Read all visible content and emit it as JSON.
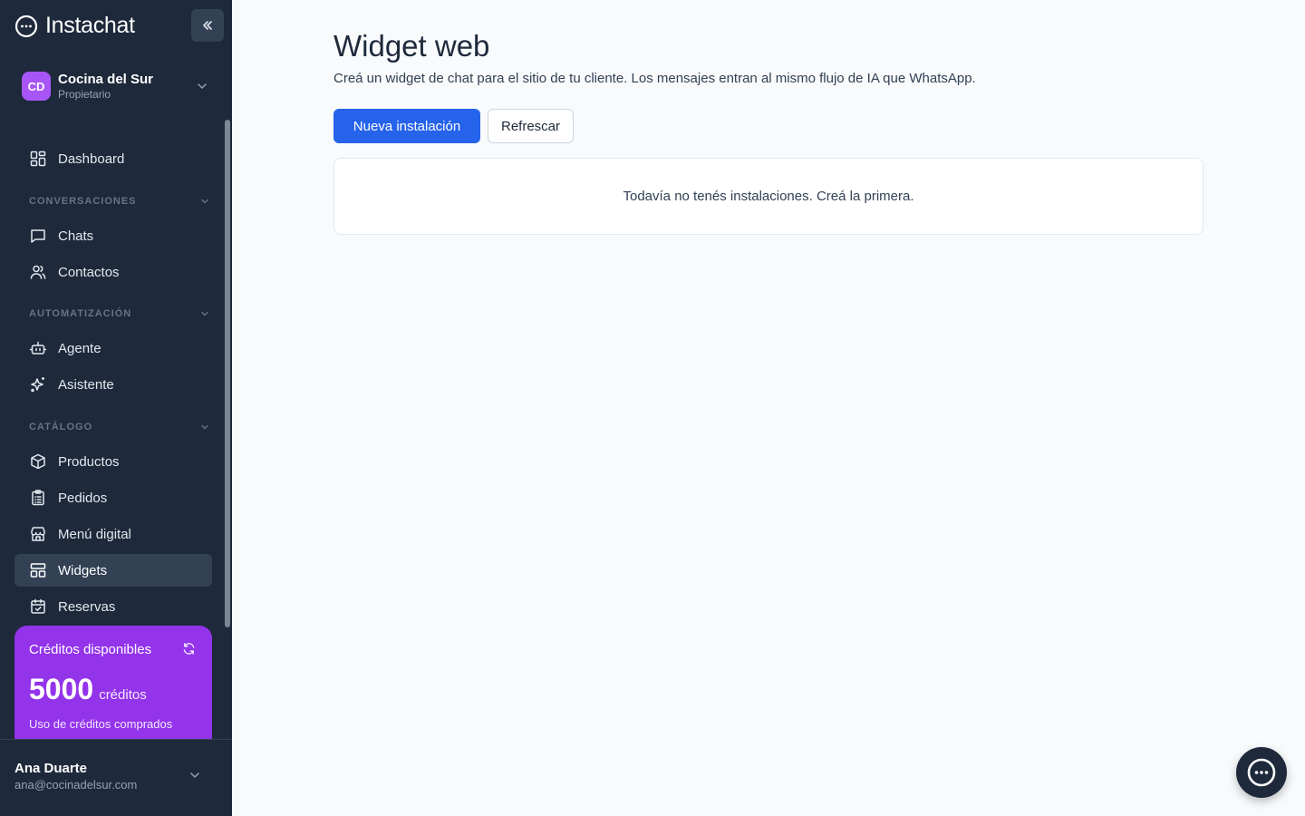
{
  "app": {
    "name": "Instachat"
  },
  "workspace": {
    "initials": "CD",
    "name": "Cocina del Sur",
    "role": "Propietario"
  },
  "nav": {
    "dashboard": "Dashboard",
    "sections": {
      "conversaciones": "CONVERSACIONES",
      "automatizacion": "AUTOMATIZACIÓN",
      "catalogo": "CATÁLOGO"
    },
    "chats": "Chats",
    "contactos": "Contactos",
    "agente": "Agente",
    "asistente": "Asistente",
    "productos": "Productos",
    "pedidos": "Pedidos",
    "menu_digital": "Menú digital",
    "widgets": "Widgets",
    "reservas": "Reservas",
    "active": "Widgets"
  },
  "credits": {
    "title": "Créditos disponibles",
    "amount": "5000",
    "unit": "créditos",
    "subtitle": "Uso de créditos comprados"
  },
  "user": {
    "name": "Ana Duarte",
    "email": "ana@cocinadelsur.com"
  },
  "page": {
    "title": "Widget web",
    "description": "Creá un widget de chat para el sitio de tu cliente. Los mensajes entran al mismo flujo de IA que WhatsApp.",
    "primary_button": "Nueva instalación",
    "secondary_button": "Refrescar",
    "empty_message": "Todavía no tenés instalaciones. Creá la primera."
  },
  "colors": {
    "sidebar_bg": "#1e293b",
    "primary": "#2563eb",
    "credits_bg": "#9333ea",
    "avatar_bg": "#a855f7"
  }
}
